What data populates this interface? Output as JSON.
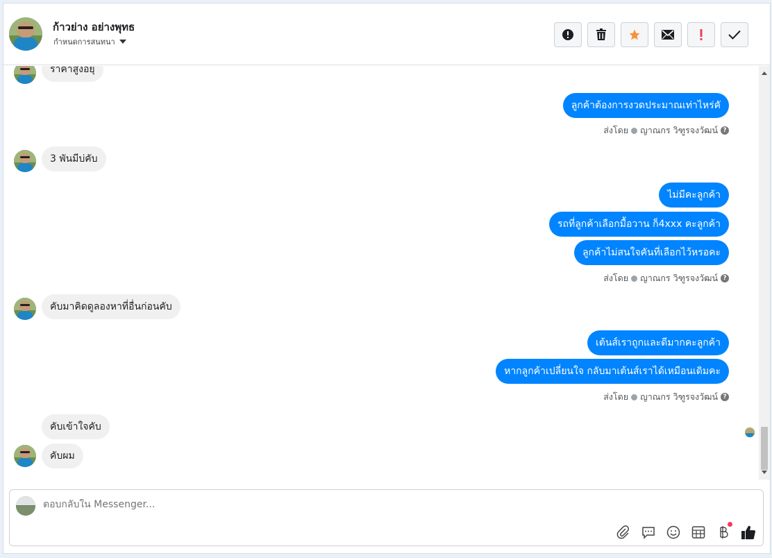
{
  "header": {
    "contact_name": "ก้าวย่าง อย่างพุทธ",
    "assign_label": "กำหนดการสนทนา",
    "actions": [
      "info-icon",
      "trash-icon",
      "star-icon",
      "mail-icon",
      "exclamation-icon",
      "check-icon"
    ]
  },
  "messages": [
    {
      "dir": "in",
      "text": "ราคาสูงอยุ่",
      "avatar": true
    },
    {
      "dir": "out",
      "text": "ลูกค้าต้องการงวดประมาณเท่าไหร่คั"
    },
    {
      "dir": "in",
      "text": "3 พันมีบ่คับ",
      "avatar": true
    },
    {
      "dir": "out",
      "text": "ไม่มีคะลูกค้า"
    },
    {
      "dir": "out",
      "text": "รถที่ลูกค้าเลือกมื้อวาน ก็4xxx คะลูกค้า"
    },
    {
      "dir": "out",
      "text": "ลูกค้าไม่สนใจคันที่เลือกไว้หรอคะ"
    },
    {
      "dir": "in",
      "text": "คับมาคิดดูลองหาที่อื่นก่อนคับ",
      "avatar": true
    },
    {
      "dir": "out",
      "text": "เต้นส์เราถูกและดีมากคะลูกค้า"
    },
    {
      "dir": "out",
      "text": "หากลูกค้าเปลี่ยนใจ กลับมาเต้นส์เราได้เหมือนเดิมคะ"
    },
    {
      "dir": "in",
      "text": "คับเข้าใจคับ",
      "avatar": false
    },
    {
      "dir": "in",
      "text": "คับผม",
      "avatar": true
    }
  ],
  "sent_by": {
    "prefix": "ส่งโดย",
    "agent": "ญาณกร วิฑูรจงวัฒน์",
    "help": "?"
  },
  "composer": {
    "placeholder": "ตอบกลับใน Messenger...",
    "tools": [
      "paperclip-icon",
      "speech-bubble-icon",
      "smiley-icon",
      "calculator-icon",
      "baht-icon",
      "thumbs-up-icon"
    ]
  },
  "colors": {
    "outgoing_bubble": "#0084ff",
    "incoming_bubble": "#f0f0f0",
    "star": "#f7923a",
    "exclamation": "#f33b5b"
  }
}
